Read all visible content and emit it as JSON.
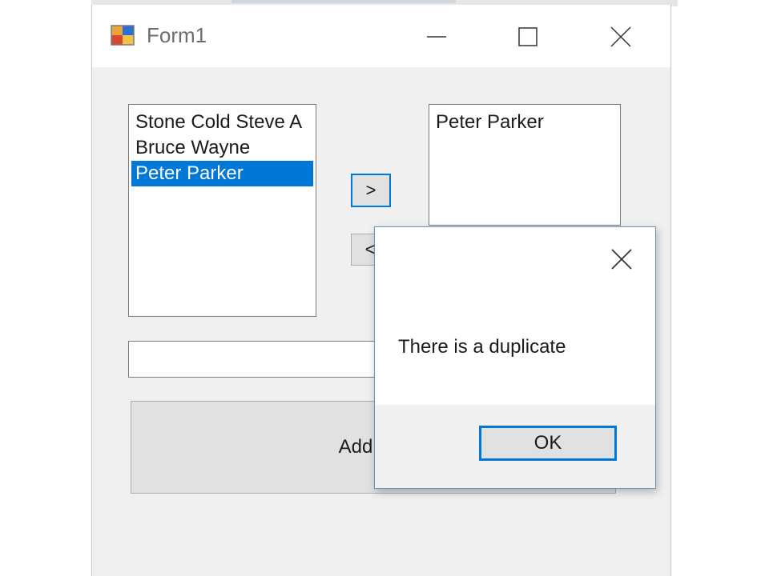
{
  "window": {
    "title": "Form1",
    "icon": "form-app-icon",
    "controls": {
      "minimize_icon": "minimize-icon",
      "maximize_icon": "maximize-icon",
      "close_icon": "close-icon"
    }
  },
  "source_list": {
    "items": [
      {
        "label": "Stone Cold Steve A",
        "selected": false
      },
      {
        "label": "Bruce Wayne",
        "selected": false
      },
      {
        "label": "Peter Parker",
        "selected": true
      }
    ]
  },
  "target_list": {
    "items": [
      {
        "label": "Peter Parker"
      }
    ]
  },
  "buttons": {
    "move_right": ">",
    "move_left": "<",
    "add": "Add to li"
  },
  "textbox": {
    "value": ""
  },
  "dialog": {
    "message": "There is a duplicate",
    "ok_label": "OK",
    "close_icon": "close-icon"
  },
  "colors": {
    "accent": "#0078d7",
    "selection": "#0078d7",
    "window_bg": "#f0f0f0"
  }
}
